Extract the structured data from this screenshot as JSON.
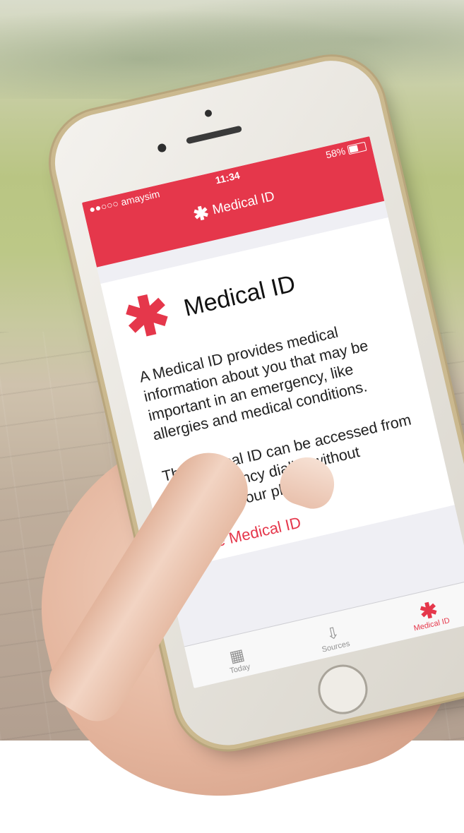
{
  "status_bar": {
    "carrier": "●●○○○ amaysim",
    "time": "11:34",
    "battery_text": "58%",
    "battery_level": 0.58
  },
  "nav": {
    "title": "Medical ID",
    "icon": "asterisk-icon"
  },
  "card": {
    "title": "Medical ID",
    "description": "A Medical ID provides medical information about you that may be important in an emergency, like allergies and medical conditions.",
    "description2": "The Medical ID can be accessed from the emergency dialler without unlocking your phone.",
    "create_label": "Create Medical ID"
  },
  "tabs": [
    {
      "label": "Today",
      "icon": "calendar-icon",
      "active": false
    },
    {
      "label": "Sources",
      "icon": "download-icon",
      "active": false
    },
    {
      "label": "Medical ID",
      "icon": "asterisk-icon",
      "active": true
    }
  ],
  "colors": {
    "accent": "#e5374b",
    "background": "#efeff4"
  }
}
